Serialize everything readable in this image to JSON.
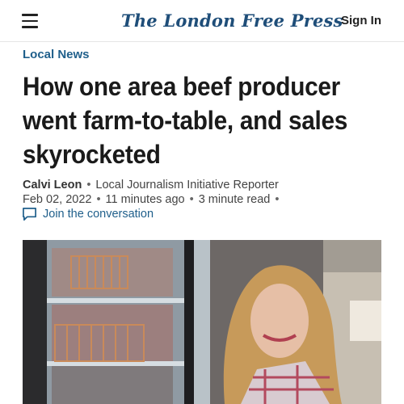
{
  "header": {
    "logo_text": "The London Free Press",
    "sign_in_label": "Sign In",
    "menu_icon": "hamburger-menu-icon"
  },
  "article": {
    "section": "Local News",
    "headline": "How one area beef producer went farm-to-table, and sales skyrocketed",
    "author": "Calvi Leon",
    "author_role": "Local Journalism Initiative Reporter",
    "date": "Feb 02, 2022",
    "time_ago": "11 minutes ago",
    "read_time": "3 minute read",
    "conversation_label": "Join the conversation",
    "conversation_icon": "chat-bubble-icon"
  },
  "colors": {
    "brand": "#1f4e79",
    "link": "#1f5f8b",
    "headline": "#1a1a1a"
  }
}
